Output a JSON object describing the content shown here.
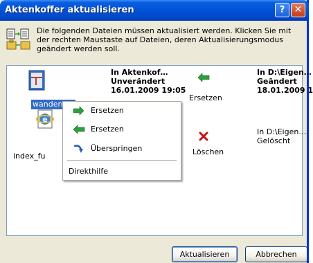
{
  "window": {
    "title": "Aktenkoffer aktualisieren",
    "help_glyph": "?",
    "close_glyph": "✕"
  },
  "info": {
    "icon": "briefcase-sync-icon",
    "text": "Die folgenden Dateien müssen aktualisiert werden. Klicken Sie mit der rechten Maustaste auf Dateien, deren Aktualisierungsmodus geändert werden soll."
  },
  "files": [
    {
      "name": "wandern",
      "icon": "document-icon",
      "left_location": "In Aktenkof…",
      "left_status": "Unverändert",
      "left_date": "16.01.2009 19:05",
      "action": "Ersetzen",
      "action_icon": "arrow-left-green-icon",
      "right_location": "In D:\\Eigen…",
      "right_status": "Geändert",
      "right_date": "18.01.2009 13"
    },
    {
      "name": "index_fu",
      "icon": "internet-explorer-icon",
      "action": "Löschen",
      "action_icon": "delete-x-red-icon",
      "right_location": "In D:\\Eigen…",
      "right_status": "Gelöscht"
    }
  ],
  "context_menu": {
    "items": [
      {
        "label": "Ersetzen",
        "icon": "arrow-right-green-icon"
      },
      {
        "label": "Ersetzen",
        "icon": "arrow-left-green-icon"
      },
      {
        "label": "Überspringen",
        "icon": "skip-arrow-icon"
      }
    ],
    "help_label": "Direkthilfe"
  },
  "buttons": {
    "update_label": "Aktualisieren",
    "cancel_label": "Abbrechen"
  },
  "colors": {
    "titlebar": "#0052d6",
    "selection": "#316ac5",
    "dialog_bg": "#ece9d8",
    "arrow_green": "#2e9e3e",
    "delete_red": "#cc1111"
  }
}
